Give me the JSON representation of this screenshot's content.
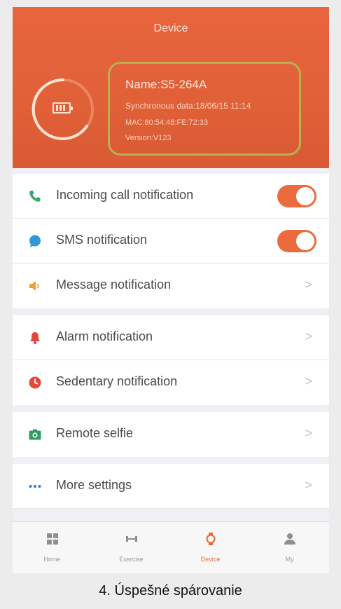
{
  "header": {
    "title": "Device",
    "device": {
      "name": "Name:S5-264A",
      "sync": "Synchronous data:18/06/15 11:14",
      "mac": "MAC:80:54:48:FE:72:33",
      "version": "Version:V123"
    },
    "battery_icon": "battery-icon"
  },
  "rows": [
    {
      "label": "Incoming call notification",
      "icon": "phone-icon",
      "control": "toggle",
      "on": true
    },
    {
      "label": "SMS notification",
      "icon": "chat-bubble-icon",
      "control": "toggle",
      "on": true
    },
    {
      "label": "Message notification",
      "icon": "speaker-icon",
      "control": "chevron"
    },
    {
      "label": "Alarm notification",
      "icon": "bell-icon",
      "control": "chevron"
    },
    {
      "label": "Sedentary notification",
      "icon": "clock-icon",
      "control": "chevron"
    },
    {
      "label": "Remote selfie",
      "icon": "camera-icon",
      "control": "chevron"
    },
    {
      "label": "More settings",
      "icon": "more-dots-icon",
      "control": "chevron"
    }
  ],
  "chevron": ">",
  "tabbar": {
    "tabs": [
      {
        "label": "Home",
        "icon": "grid-icon",
        "active": false
      },
      {
        "label": "Exercise",
        "icon": "dumbbell-icon",
        "active": false
      },
      {
        "label": "Device",
        "icon": "watch-icon",
        "active": true
      },
      {
        "label": "My",
        "icon": "person-icon",
        "active": false
      }
    ]
  },
  "caption": "4. Úspešné spárovanie",
  "colors": {
    "accent": "#e8653e",
    "toggle_on": "#ec6b3d",
    "info_border": "#b9b04e"
  }
}
